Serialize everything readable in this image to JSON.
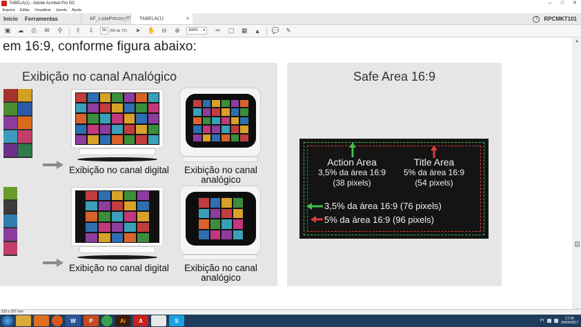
{
  "window": {
    "title": "TABELA(1) - Adobe Acrobat Pro DC"
  },
  "menu": [
    "Arquivo",
    "Editar",
    "Visualizar",
    "Janela",
    "Ajuda"
  ],
  "tabs": {
    "nav": [
      "Início",
      "Ferramentas"
    ],
    "docs": [
      {
        "label": "AF_ListaPrecos_TV_...",
        "active": false
      },
      {
        "label": "TABELA(1)",
        "active": true
      }
    ],
    "user": "RPCMKT101"
  },
  "toolbar": {
    "page_current": "56",
    "page_count": "(56 de 72)",
    "zoom": "300%"
  },
  "document": {
    "heading": "em 16:9, conforme figura abaixo:",
    "left_panel": {
      "title": "Exibição no canal Analógico",
      "rows": [
        {
          "digital_caption": "Exibição no canal digital",
          "analog_caption_1": "Exibição no canal",
          "analog_caption_2": "analógico"
        },
        {
          "digital_caption": "Exibição no canal digital",
          "analog_caption_1": "Exibição no canal",
          "analog_caption_2": "analógico"
        }
      ]
    },
    "right_panel": {
      "title": "Safe Area 16:9",
      "action_area": {
        "title": "Action Area",
        "line1": "3,5% da área 16:9",
        "line2": "(38 pixels)"
      },
      "title_area": {
        "title": "Title Area",
        "line1": "5% da área 16:9",
        "line2": "(54 pixels)"
      },
      "green_line": "3,5% da área 16:9 (76 pixels)",
      "red_line": "5% da área 16:9 (96 pixels)",
      "colors": {
        "action": "#3fbf4f",
        "title": "#e0383a",
        "box": "#141414"
      }
    }
  },
  "status": {
    "page_size": "210 x 297 mm"
  },
  "taskbar": {
    "apps": [
      "explorer-icon",
      "media-icon",
      "firefox-icon",
      "word-icon",
      "powerpoint-icon",
      "chrome-icon",
      "illustrator-icon",
      "acrobat-icon",
      "file-icon",
      "skype-icon"
    ],
    "locale": "PT",
    "time": "17:39",
    "date": "24/04/2017"
  }
}
